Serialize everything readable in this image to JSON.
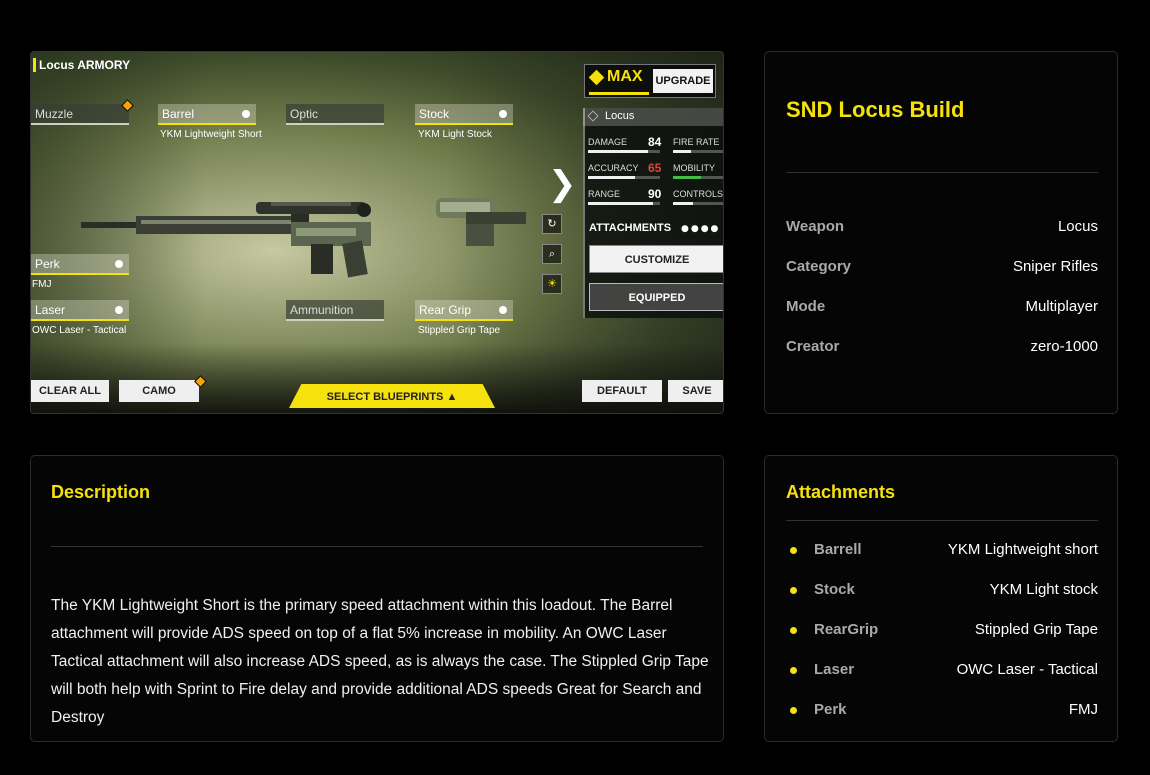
{
  "game": {
    "armory_title": "Locus ARMORY",
    "max_label": "MAX",
    "upgrade_label": "UPGRADE",
    "weapon_name": "Locus",
    "slots": {
      "muzzle": "Muzzle",
      "barrel": "Barrel",
      "barrel_value": "YKM Lightweight Short",
      "optic": "Optic",
      "stock": "Stock",
      "stock_value": "YKM Light Stock",
      "perk": "Perk",
      "perk_value": "FMJ",
      "laser": "Laser",
      "laser_value": "OWC Laser - Tactical",
      "ammunition": "Ammunition",
      "rear_grip": "Rear Grip",
      "rear_grip_value": "Stippled Grip Tape"
    },
    "stats": {
      "damage_label": "DAMAGE",
      "damage_value": "84",
      "damage": 0.84,
      "fire_rate_label": "FIRE RATE",
      "fire_rate": 0.35,
      "accuracy_label": "ACCURACY",
      "accuracy_value": "65",
      "accuracy": 0.65,
      "mobility_label": "MOBILITY",
      "mobility": 0.55,
      "range_label": "RANGE",
      "range_value": "90",
      "range": 0.9,
      "controls_label": "CONTROLS",
      "controls": 0.4
    },
    "attachments_label": "ATTACHMENTS",
    "customize_label": "CUSTOMIZE",
    "equipped_label": "EQUIPPED",
    "clear_all_label": "CLEAR ALL",
    "camo_label": "CAMO",
    "blueprints_label": "SELECT BLUEPRINTS",
    "default_label": "DEFAULT",
    "save_label": "SAVE",
    "accent_color": "#f5e10c"
  },
  "build": {
    "title": "SND Locus Build",
    "rows": [
      {
        "key": "Weapon",
        "value": "Locus"
      },
      {
        "key": "Category",
        "value": "Sniper Rifles"
      },
      {
        "key": "Mode",
        "value": "Multiplayer"
      },
      {
        "key": "Creator",
        "value": "zero-1000"
      }
    ]
  },
  "description": {
    "title": "Description",
    "text": "The YKM Lightweight Short is the primary speed attachment within this loadout. The Barrel attachment will provide ADS speed on top of a flat 5% increase in mobility. An OWC Laser Tactical attachment will also increase ADS speed, as is always the case. The Stippled Grip Tape will both help with Sprint to Fire delay and provide additional ADS speeds Great for Search and Destroy"
  },
  "attachments": {
    "title": "Attachments",
    "rows": [
      {
        "key": "Barrell",
        "value": "YKM Lightweight short"
      },
      {
        "key": "Stock",
        "value": "YKM Light stock"
      },
      {
        "key": "RearGrip",
        "value": "Stippled Grip Tape"
      },
      {
        "key": "Laser",
        "value": "OWC Laser - Tactical"
      },
      {
        "key": "Perk",
        "value": "FMJ"
      }
    ]
  }
}
